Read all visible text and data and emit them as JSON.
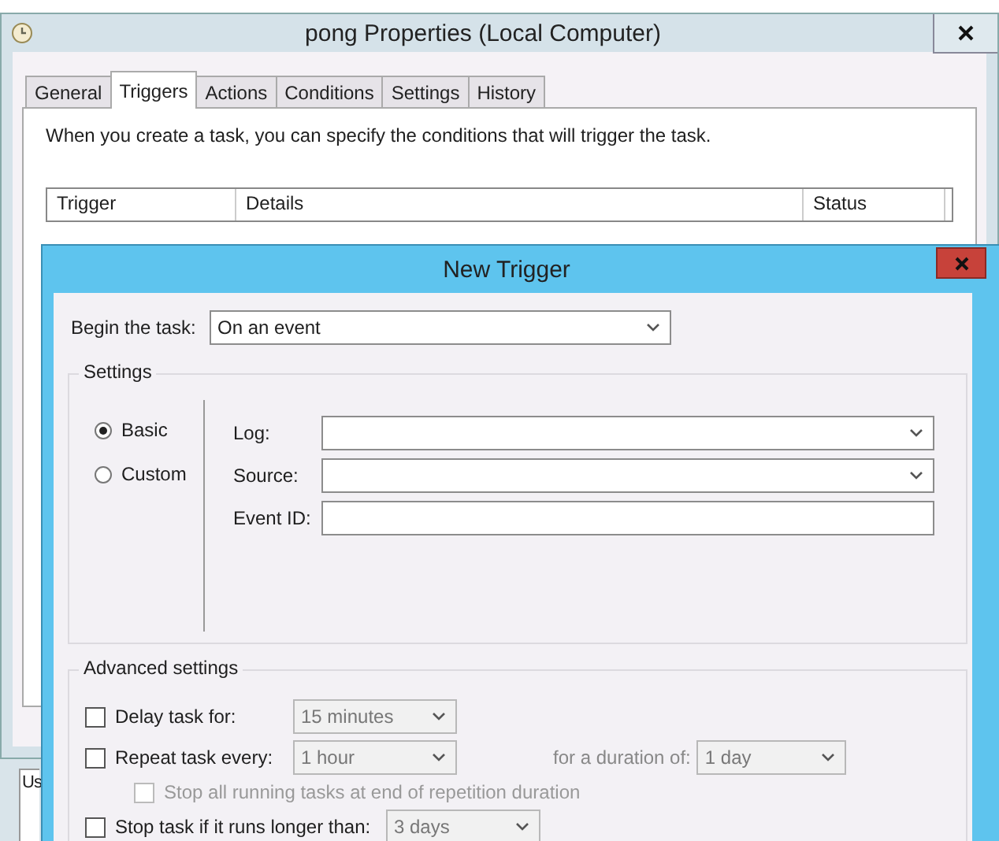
{
  "properties_window": {
    "title": "pong Properties (Local Computer)",
    "tabs": [
      {
        "label": "General",
        "selected": false
      },
      {
        "label": "Triggers",
        "selected": true
      },
      {
        "label": "Actions",
        "selected": false
      },
      {
        "label": "Conditions",
        "selected": false
      },
      {
        "label": "Settings",
        "selected": false
      },
      {
        "label": "History",
        "selected": false
      }
    ],
    "description": "When you create a task, you can specify the conditions that will trigger the task.",
    "trigger_table": {
      "columns": [
        "Trigger",
        "Details",
        "Status"
      ]
    }
  },
  "background_list": {
    "column_1": "Us"
  },
  "new_trigger": {
    "title": "New Trigger",
    "begin_label": "Begin the task:",
    "begin_value": "On an event",
    "settings": {
      "legend": "Settings",
      "radios": [
        {
          "label": "Basic",
          "selected": true
        },
        {
          "label": "Custom",
          "selected": false
        }
      ],
      "fields": [
        {
          "label": "Log:",
          "kind": "dropdown"
        },
        {
          "label": "Source:",
          "kind": "dropdown"
        },
        {
          "label": "Event ID:",
          "kind": "text"
        }
      ]
    },
    "advanced": {
      "legend": "Advanced settings",
      "options": [
        {
          "label": "Delay task for:",
          "checked": false,
          "disabled": false,
          "value": "15 minutes"
        },
        {
          "label": "Repeat task every:",
          "checked": false,
          "disabled": false,
          "value": "1 hour",
          "duration_label": "for a duration of:",
          "duration_value": "1 day",
          "children": [
            {
              "label": "Stop all running tasks at end of repetition duration",
              "checked": false,
              "disabled": true
            }
          ]
        },
        {
          "label": "Stop task if it runs longer than:",
          "checked": false,
          "disabled": false,
          "value": "3 days"
        }
      ]
    }
  }
}
